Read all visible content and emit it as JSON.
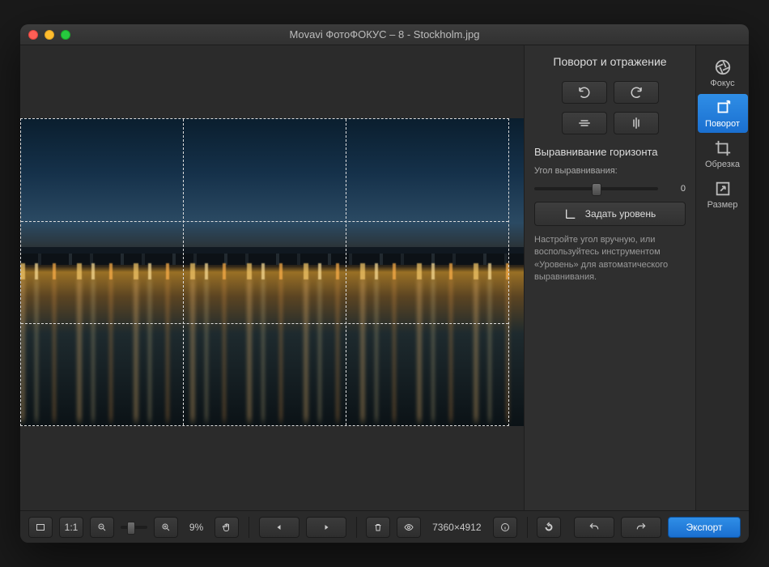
{
  "title": "Movavi ФотоФОКУС – 8 - Stockholm.jpg",
  "panel": {
    "title1": "Поворот и отражение",
    "title2": "Выравнивание горизонта",
    "angle_label": "Угол выравнивания:",
    "angle_value": "0",
    "level_button": "Задать уровень",
    "hint": "Настройте угол вручную, или воспользуйтесь инструментом «Уровень» для автоматического выравнивания."
  },
  "rail": {
    "focus": "Фокус",
    "rotate": "Поворот",
    "crop": "Обрезка",
    "resize": "Размер"
  },
  "bottom": {
    "fit_label": "1:1",
    "zoom_pct": "9%",
    "dimensions": "7360×4912",
    "export": "Экспорт"
  }
}
